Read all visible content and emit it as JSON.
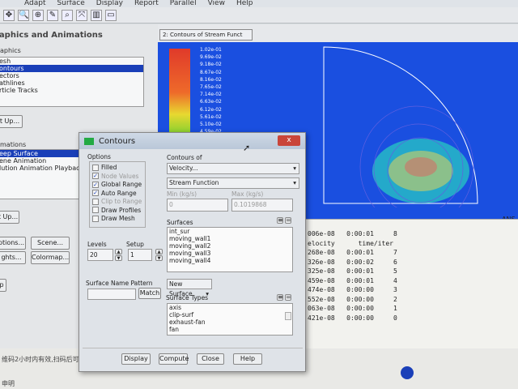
{
  "menu": [
    "Adapt",
    "Surface",
    "Display",
    "Report",
    "Parallel",
    "View",
    "Help"
  ],
  "left_panel": {
    "title": "raphics and Animations",
    "graphics_label": "aphics",
    "graphics_items": [
      "esh",
      "ontours",
      "ectors",
      "athlines",
      "rticle Tracks"
    ],
    "selected_graphics": 1,
    "setup1": "t Up...",
    "animations_label": "mations",
    "animation_items": [
      "eep Surface",
      "ene Animation",
      "lution Animation Playback"
    ],
    "setup2": "t Up...",
    "options": "ptions...",
    "scene": "Scene...",
    "lights": "ghts...",
    "colormap": "Colormap...",
    "help": "p"
  },
  "graphics": {
    "tab": "2: Contours of Stream Funct",
    "legend": [
      "1.02e-01",
      "9.69e-02",
      "9.18e-02",
      "8.67e-02",
      "8.16e-02",
      "7.65e-02",
      "7.14e-02",
      "6.63e-02",
      "6.12e-02",
      "5.61e-02",
      "5.10e-02",
      "4.59e-02"
    ],
    "brand": "ANS"
  },
  "console": {
    "rows": [
      "006e-08   0:00:01     8",
      "elocity      time/iter",
      "268e-08   0:00:01     7",
      "326e-08   0:00:02     6",
      "325e-08   0:00:01     5",
      "459e-08   0:00:01     4",
      "474e-08   0:00:00     3",
      "552e-08   0:00:00     2",
      "063e-08   0:00:00     1",
      "421e-08   0:00:00     0"
    ]
  },
  "bottom": {
    "line1": "维码2小时内有效,扫码后可分享给好友查看",
    "line2": "申明"
  },
  "dialog": {
    "title": "Contours",
    "close": "x",
    "options_label": "Options",
    "options": [
      {
        "label": "Filled",
        "checked": false,
        "enabled": true
      },
      {
        "label": "Node Values",
        "checked": true,
        "enabled": false
      },
      {
        "label": "Global Range",
        "checked": true,
        "enabled": true
      },
      {
        "label": "Auto Range",
        "checked": true,
        "enabled": true
      },
      {
        "label": "Clip to Range",
        "checked": false,
        "enabled": false
      },
      {
        "label": "Draw Profiles",
        "checked": false,
        "enabled": true
      },
      {
        "label": "Draw Mesh",
        "checked": false,
        "enabled": true
      }
    ],
    "contours_of_label": "Contours of",
    "contours_of": "Velocity...",
    "quantity": "Stream Function",
    "min_label": "Min (kg/s)",
    "min": "0",
    "max_label": "Max (kg/s)",
    "max": "0.1019868",
    "surfaces_label": "Surfaces",
    "surfaces": [
      "int_sur",
      "moving_wall1",
      "moving_wall2",
      "moving_wall3",
      "moving_wall4"
    ],
    "levels_label": "Levels",
    "levels": "20",
    "setup_label": "Setup",
    "setup": "1",
    "pattern_label": "Surface Name Pattern",
    "pattern": "",
    "match": "Match",
    "new_surface": "New Surface",
    "surface_types_label": "Surface Types",
    "surface_types": [
      "axis",
      "clip-surf",
      "exhaust-fan",
      "fan"
    ],
    "buttons": {
      "display": "Display",
      "compute": "Compute",
      "close": "Close",
      "help": "Help"
    }
  }
}
